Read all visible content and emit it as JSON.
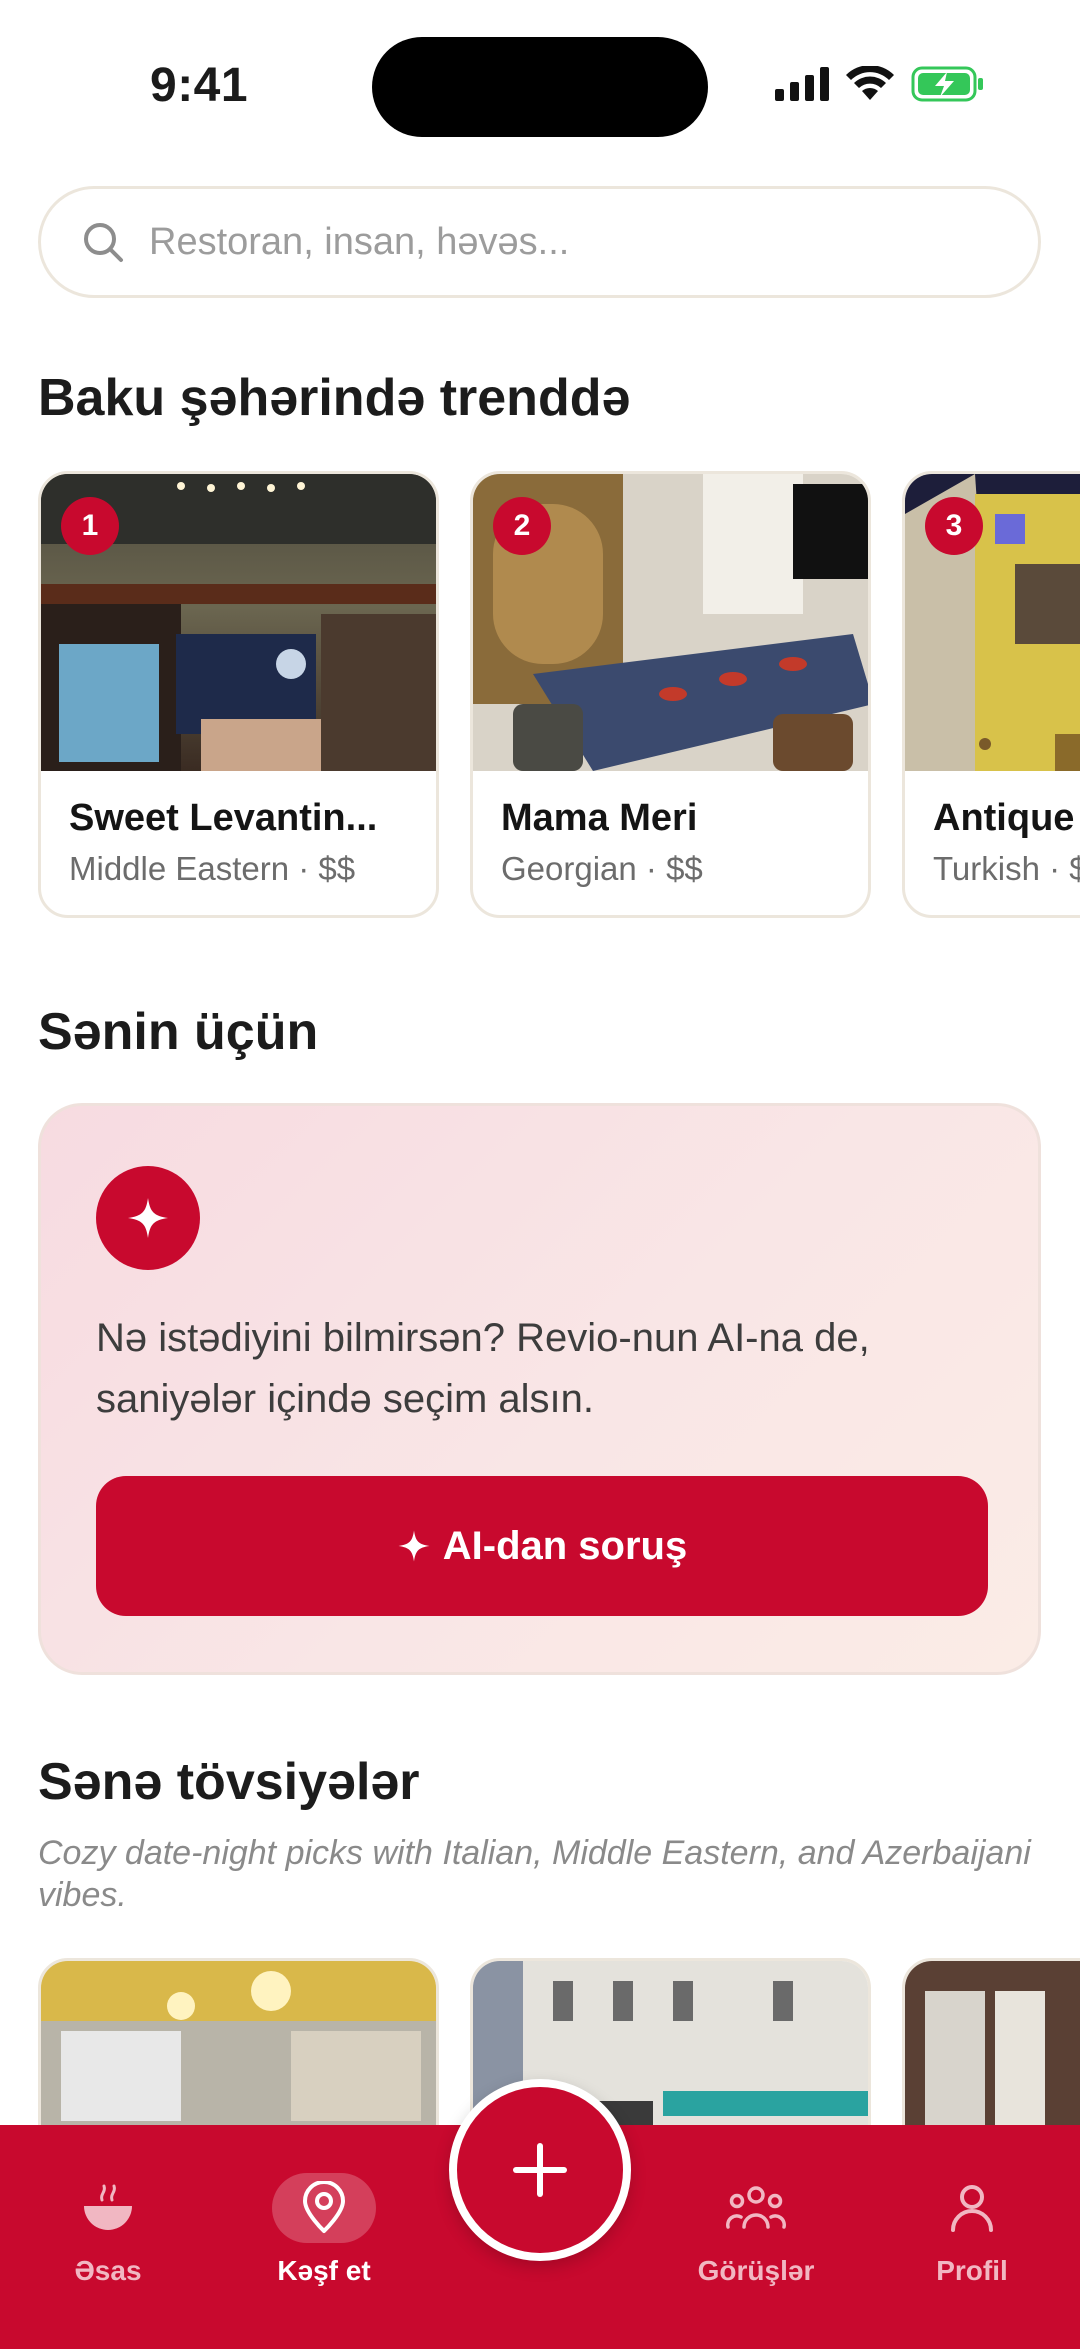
{
  "status_bar": {
    "time": "9:41"
  },
  "search": {
    "placeholder": "Restoran, insan, həvəs..."
  },
  "trending": {
    "title": "Baku şəhərində trenddə",
    "cards": [
      {
        "rank": "1",
        "name": "Sweet Levantin...",
        "meta": "Middle Eastern · $$"
      },
      {
        "rank": "2",
        "name": "Mama Meri",
        "meta": "Georgian · $$"
      },
      {
        "rank": "3",
        "name": "Antique",
        "meta": "Turkish · $"
      }
    ]
  },
  "for_you": {
    "title": "Sənin üçün",
    "ai_text": "Nə istədiyini bilmirsən? Revio-nun AI-na de, saniyələr içində seçim alsın.",
    "ai_button": "AI-dan soruş"
  },
  "recommendations": {
    "title": "Sənə tövsiyələr",
    "subtitle": "Cozy date-night picks with Italian, Middle Eastern, and Azerbaijani vibes."
  },
  "nav": {
    "items": [
      {
        "label": "Əsas",
        "icon": "bowl-icon",
        "active": false
      },
      {
        "label": "Kəşf et",
        "icon": "map-pin-icon",
        "active": true
      },
      {
        "label": "Görüşlər",
        "icon": "people-icon",
        "active": false
      },
      {
        "label": "Profil",
        "icon": "user-icon",
        "active": false
      }
    ],
    "fab_icon": "plus-icon"
  },
  "colors": {
    "brand": "#c8092e",
    "card_border": "#ece6dc",
    "battery": "#34c759"
  }
}
